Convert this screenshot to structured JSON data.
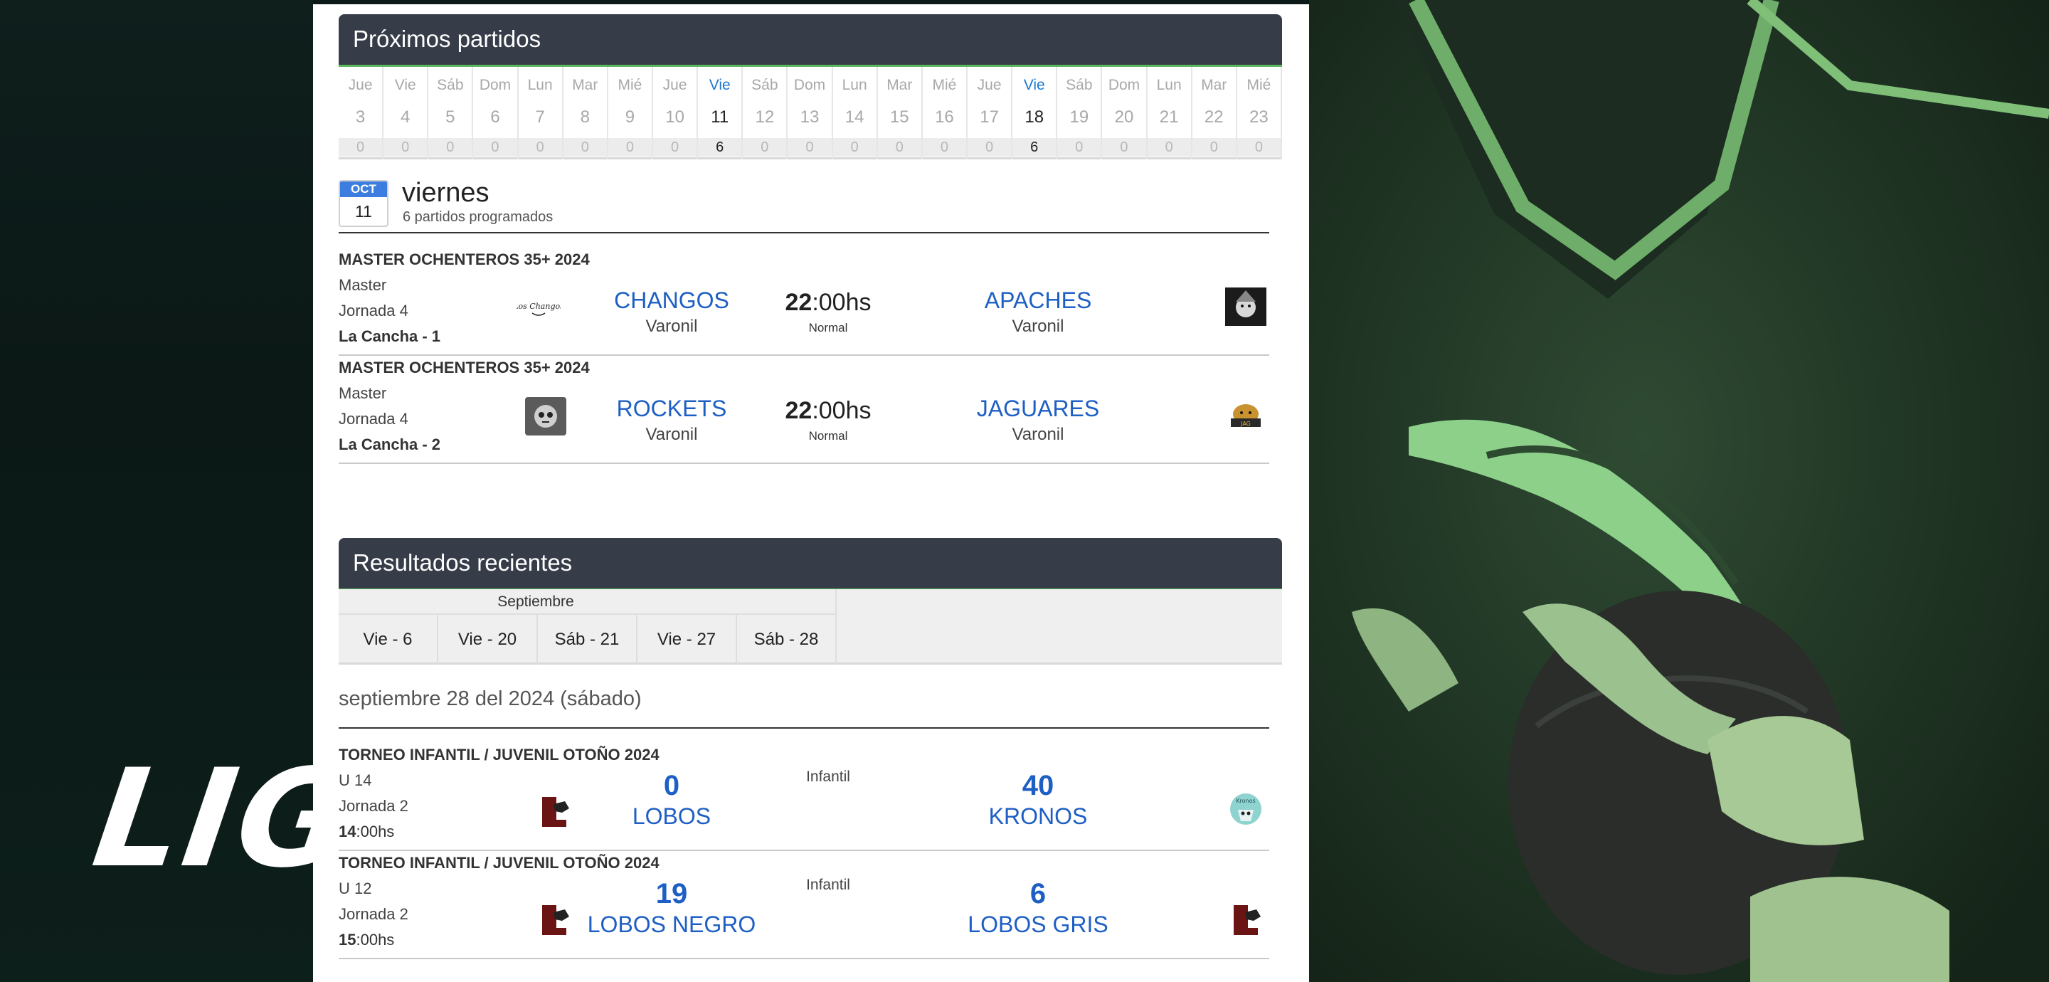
{
  "brand": {
    "wordmark": "LIGA"
  },
  "upcoming": {
    "title": "Próximos partidos",
    "calendar": [
      {
        "dn": "Jue",
        "dd": "3",
        "cnt": "0",
        "active": false
      },
      {
        "dn": "Vie",
        "dd": "4",
        "cnt": "0",
        "active": false
      },
      {
        "dn": "Sáb",
        "dd": "5",
        "cnt": "0",
        "active": false
      },
      {
        "dn": "Dom",
        "dd": "6",
        "cnt": "0",
        "active": false
      },
      {
        "dn": "Lun",
        "dd": "7",
        "cnt": "0",
        "active": false
      },
      {
        "dn": "Mar",
        "dd": "8",
        "cnt": "0",
        "active": false
      },
      {
        "dn": "Mié",
        "dd": "9",
        "cnt": "0",
        "active": false
      },
      {
        "dn": "Jue",
        "dd": "10",
        "cnt": "0",
        "active": false
      },
      {
        "dn": "Vie",
        "dd": "11",
        "cnt": "6",
        "active": true
      },
      {
        "dn": "Sáb",
        "dd": "12",
        "cnt": "0",
        "active": false
      },
      {
        "dn": "Dom",
        "dd": "13",
        "cnt": "0",
        "active": false
      },
      {
        "dn": "Lun",
        "dd": "14",
        "cnt": "0",
        "active": false
      },
      {
        "dn": "Mar",
        "dd": "15",
        "cnt": "0",
        "active": false
      },
      {
        "dn": "Mié",
        "dd": "16",
        "cnt": "0",
        "active": false
      },
      {
        "dn": "Jue",
        "dd": "17",
        "cnt": "0",
        "active": false
      },
      {
        "dn": "Vie",
        "dd": "18",
        "cnt": "6",
        "active": true
      },
      {
        "dn": "Sáb",
        "dd": "19",
        "cnt": "0",
        "active": false
      },
      {
        "dn": "Dom",
        "dd": "20",
        "cnt": "0",
        "active": false
      },
      {
        "dn": "Lun",
        "dd": "21",
        "cnt": "0",
        "active": false
      },
      {
        "dn": "Mar",
        "dd": "22",
        "cnt": "0",
        "active": false
      },
      {
        "dn": "Mié",
        "dd": "23",
        "cnt": "0",
        "active": false
      }
    ],
    "day": {
      "month": "OCT",
      "date": "11",
      "title": "viernes",
      "subtitle": "6 partidos programados"
    },
    "matches": [
      {
        "league": "MASTER OCHENTEROS 35+ 2024",
        "category": "Master",
        "round": "Jornada 4",
        "venue": "La Cancha - 1",
        "home": {
          "name": "CHANGOS",
          "sub": "Varonil",
          "logo": "changos-logo-icon"
        },
        "time_h": "22",
        "time_rest": ":00hs",
        "time_note": "Normal",
        "away": {
          "name": "APACHES",
          "sub": "Varonil",
          "logo": "apaches-logo-icon"
        }
      },
      {
        "league": "MASTER OCHENTEROS 35+ 2024",
        "category": "Master",
        "round": "Jornada 4",
        "venue": "La Cancha - 2",
        "home": {
          "name": "ROCKETS",
          "sub": "Varonil",
          "logo": "rockets-logo-icon"
        },
        "time_h": "22",
        "time_rest": ":00hs",
        "time_note": "Normal",
        "away": {
          "name": "JAGUARES",
          "sub": "Varonil",
          "logo": "jaguares-logo-icon"
        }
      }
    ]
  },
  "results": {
    "title": "Resultados recientes",
    "month": "Septiembre",
    "tabs": [
      "Vie - 6",
      "Vie - 20",
      "Sáb - 21",
      "Vie - 27",
      "Sáb - 28"
    ],
    "date_heading": "septiembre 28 del 2024 (sábado)",
    "matches": [
      {
        "league": "TORNEO INFANTIL / JUVENIL OTOÑO 2024",
        "category": "U 14",
        "round": "Jornada 2",
        "time_h": "14",
        "time_rest": ":00hs",
        "division": "Infantil",
        "home": {
          "score": "0",
          "name": "LOBOS",
          "logo": "lobos-logo-icon"
        },
        "away": {
          "score": "40",
          "name": "KRONOS",
          "logo": "kronos-logo-icon"
        }
      },
      {
        "league": "TORNEO INFANTIL / JUVENIL OTOÑO 2024",
        "category": "U 12",
        "round": "Jornada 2",
        "time_h": "15",
        "time_rest": ":00hs",
        "division": "Infantil",
        "home": {
          "score": "19",
          "name": "LOBOS NEGRO",
          "logo": "lobos-logo-icon"
        },
        "away": {
          "score": "6",
          "name": "LOBOS GRIS",
          "logo": "lobos-logo-icon"
        }
      }
    ]
  },
  "colors": {
    "header_bg": "#373c49",
    "accent_green": "#5bb85d",
    "link_blue": "#1e5fc4",
    "active_day": "#1a77d2"
  }
}
